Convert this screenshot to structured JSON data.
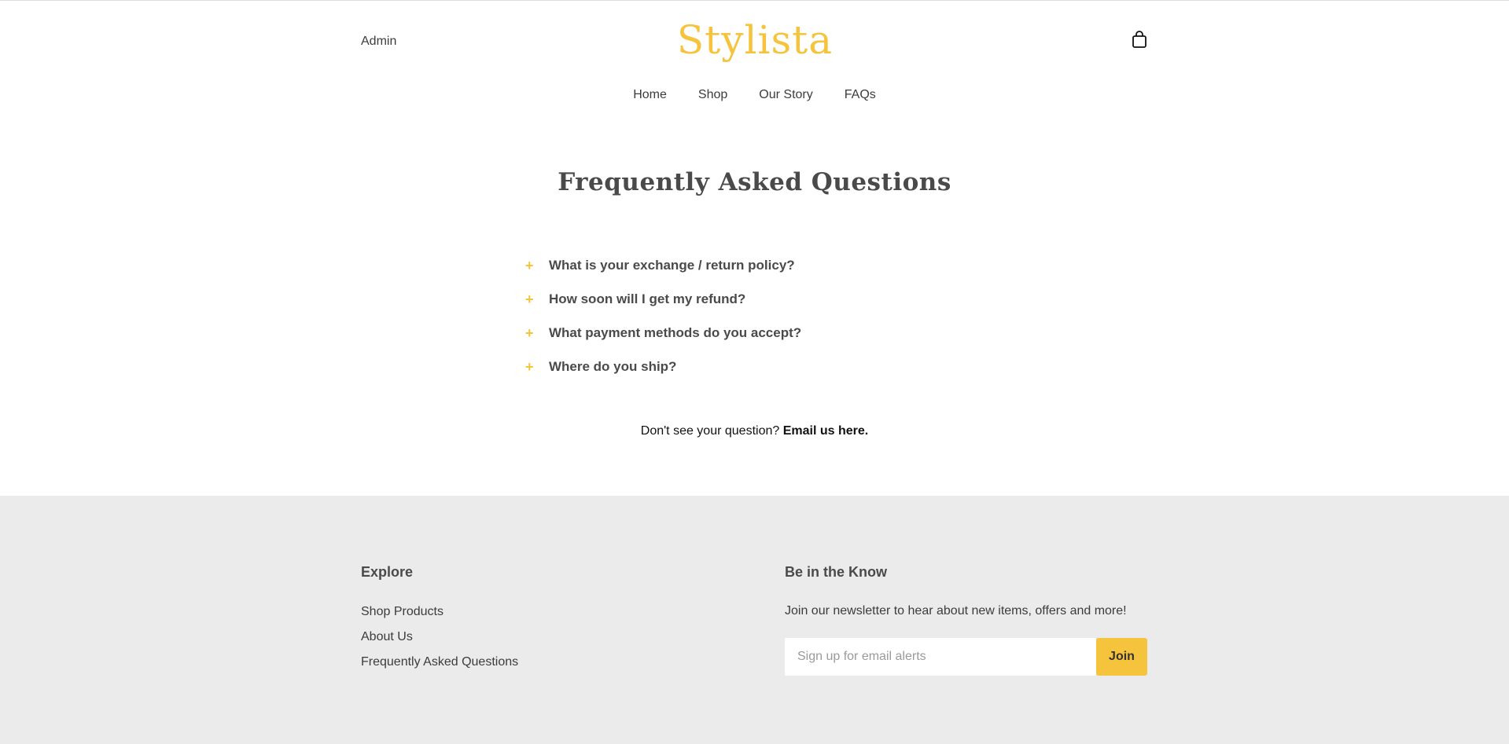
{
  "header": {
    "admin_label": "Admin",
    "logo_text": "Stylista",
    "cart_icon": "shopping-bag-icon"
  },
  "nav": {
    "items": [
      {
        "label": "Home"
      },
      {
        "label": "Shop"
      },
      {
        "label": "Our Story"
      },
      {
        "label": "FAQs"
      }
    ]
  },
  "main": {
    "title": "Frequently Asked Questions",
    "faqs": [
      {
        "icon": "+",
        "question": "What is your exchange / return policy?"
      },
      {
        "icon": "+",
        "question": "How soon will I get my refund?"
      },
      {
        "icon": "+",
        "question": "What payment methods do you accept?"
      },
      {
        "icon": "+",
        "question": "Where do you ship?"
      }
    ],
    "email_prompt": "Don't see your question?",
    "email_link": "Email us here."
  },
  "footer": {
    "explore_title": "Explore",
    "explore_links": [
      {
        "label": "Shop Products"
      },
      {
        "label": "About Us"
      },
      {
        "label": "Frequently Asked Questions"
      }
    ],
    "newsletter_title": "Be in the Know",
    "newsletter_text": "Join our newsletter to hear about new items, offers and more!",
    "signup_placeholder": "Sign up for email alerts",
    "join_label": "Join"
  },
  "colors": {
    "accent": "#f5c33c",
    "footer_bg": "#ebebeb",
    "text": "#4a4a4a"
  }
}
